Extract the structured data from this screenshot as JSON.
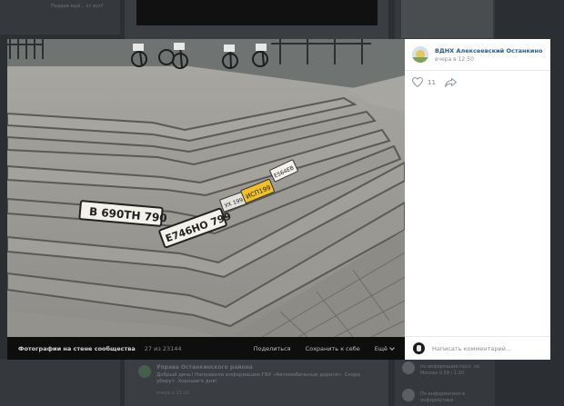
{
  "background": {
    "feed_post": {
      "author": "Управа Останкинского района",
      "text": "Добрый день! Направили информацию ГБУ «Автомобильные дороги». Скоро уберут. Хорошего дня!",
      "date": "вчера в 13:10"
    },
    "left_card_text": "Подари ещё... от вуз?",
    "right_items": [
      "по информации посл. по Москве 0.59 / 1.20",
      "По информатике в информатике"
    ]
  },
  "viewer": {
    "album_label": "Фотографии на стене сообщества",
    "counter": "27 из 23144",
    "actions": {
      "share": "Поделиться",
      "save": "Сохранить к себе",
      "more": "Ещё"
    },
    "plates": [
      "В 690ТН 790",
      "Е746НО 799",
      "УХ 199",
      "ИСП199",
      "Е564ЕВ"
    ]
  },
  "post": {
    "community_name": "ВДНХ Алексеевский Останкино",
    "time": "вчера в 12:50",
    "likes": "11",
    "comment_placeholder": "Написать комментарий..."
  },
  "colors": {
    "link": "#2a5885",
    "viewer_bg": "#000000",
    "panel_bg": "#ffffff"
  },
  "icons": {
    "like": "heart-icon",
    "share": "share-arrow-icon",
    "avatar": "community-avatar",
    "more": "chevron-down-icon"
  }
}
